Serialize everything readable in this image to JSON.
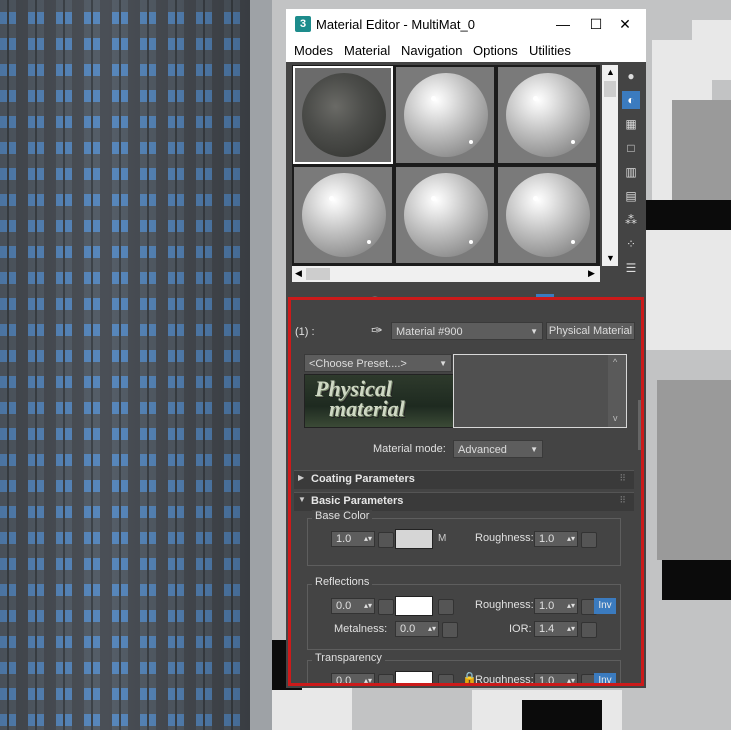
{
  "window": {
    "app_icon": "3",
    "title": "Material Editor - MultiMat_0",
    "controls": {
      "minimize": "—",
      "maximize": "☐",
      "close": "✕"
    }
  },
  "menu": [
    "Modes",
    "Material",
    "Navigation",
    "Options",
    "Utilities"
  ],
  "toolbar_icons": [
    "get-material-icon",
    "put-to-scene-icon",
    "assign-to-selection-icon",
    "reset-icon",
    "make-unique-icon",
    "put-to-library-icon",
    "material-id-icon",
    "show-shaded-icon",
    "show-end-result-icon",
    "go-to-parent-icon",
    "go-forward-icon",
    "pick-from-object-icon"
  ],
  "side_tool_icons": [
    "sample-type-icon",
    "backlight-icon",
    "background-icon",
    "uv-tiling-icon",
    "video-color-check-icon",
    "make-preview-icon",
    "options-icon",
    "select-by-material-icon",
    "material-navigator-icon"
  ],
  "material": {
    "slot_label": "(1) :",
    "name": "Material #900",
    "type_button": "Physical Material",
    "preset": "<Choose Preset....>",
    "logo_text_1": "Physical",
    "logo_text_2": "material",
    "mode_label": "Material mode:",
    "mode_value": "Advanced"
  },
  "rollouts": {
    "coating": "Coating Parameters",
    "basic": "Basic Parameters"
  },
  "base_color": {
    "title": "Base Color",
    "weight": "1.0",
    "swatch_color": "#d6d6d6",
    "map_label": "M",
    "roughness_label": "Roughness:",
    "roughness": "1.0"
  },
  "reflections": {
    "title": "Reflections",
    "weight": "0.0",
    "swatch_color": "#ffffff",
    "roughness_label": "Roughness:",
    "roughness": "1.0",
    "inv": "Inv",
    "metalness_label": "Metalness:",
    "metalness": "0.0",
    "ior_label": "IOR:",
    "ior": "1.4"
  },
  "transparency": {
    "title": "Transparency",
    "weight": "0.0",
    "swatch_color": "#ffffff",
    "roughness_label": "Roughness:",
    "roughness": "1.0",
    "inv": "Inv"
  },
  "colors": {
    "accent": "#3b7bbf",
    "highlight_border": "#cc1a1a"
  }
}
